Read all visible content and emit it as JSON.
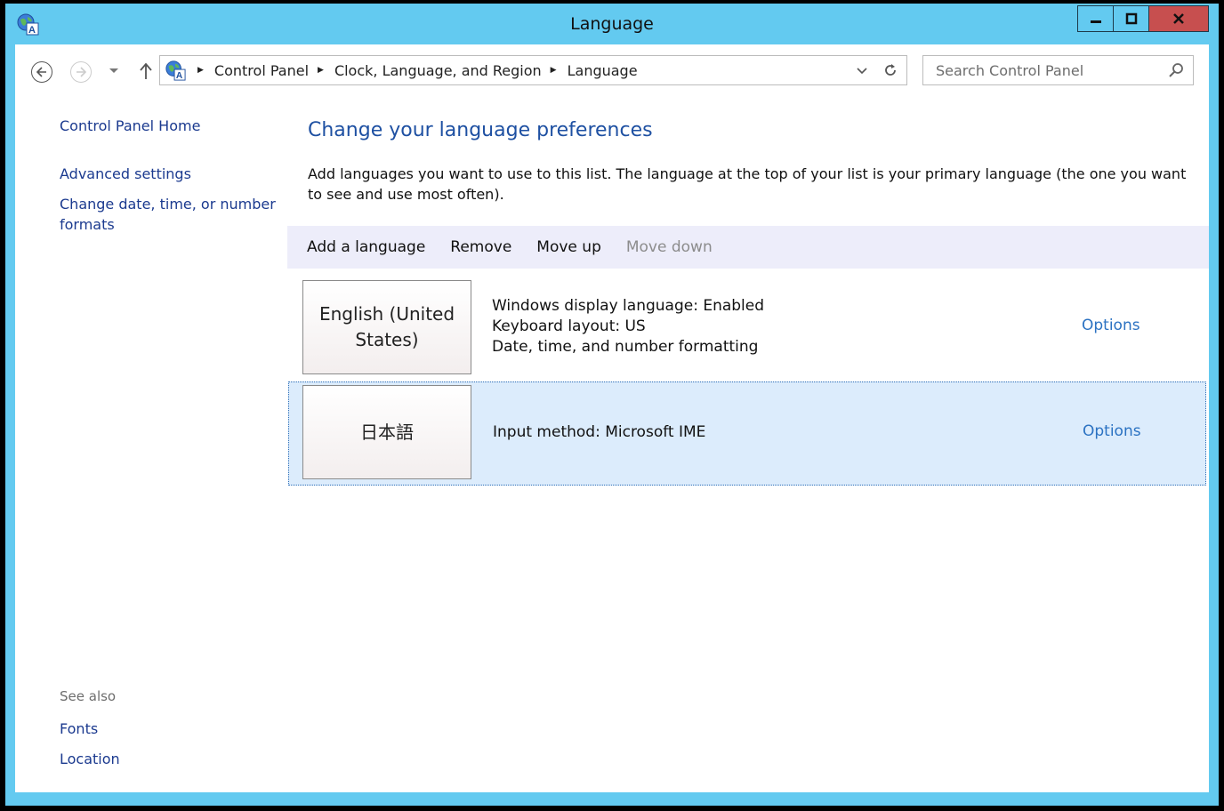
{
  "window": {
    "title": "Language",
    "accent_color": "#63caf0",
    "close_color": "#c74f4f"
  },
  "nav": {
    "breadcrumbs": [
      "Control Panel",
      "Clock, Language, and Region",
      "Language"
    ],
    "search_placeholder": "Search Control Panel"
  },
  "sidebar": {
    "links": [
      "Control Panel Home",
      "Advanced settings",
      "Change date, time, or number formats"
    ],
    "see_also_label": "See also",
    "see_also_links": [
      "Fonts",
      "Location"
    ]
  },
  "main": {
    "heading": "Change your language preferences",
    "description": "Add languages you want to use to this list. The language at the top of your list is your primary language (the one you want to see and use most often).",
    "toolbar": {
      "add": "Add a language",
      "remove": "Remove",
      "move_up": "Move up",
      "move_down": "Move down"
    },
    "languages": [
      {
        "name": "English (United States)",
        "details": [
          "Windows display language: Enabled",
          "Keyboard layout: US",
          "Date, time, and number formatting"
        ],
        "options_label": "Options",
        "selected": false
      },
      {
        "name": "日本語",
        "details": [
          "Input method: Microsoft IME"
        ],
        "options_label": "Options",
        "selected": true
      }
    ]
  }
}
